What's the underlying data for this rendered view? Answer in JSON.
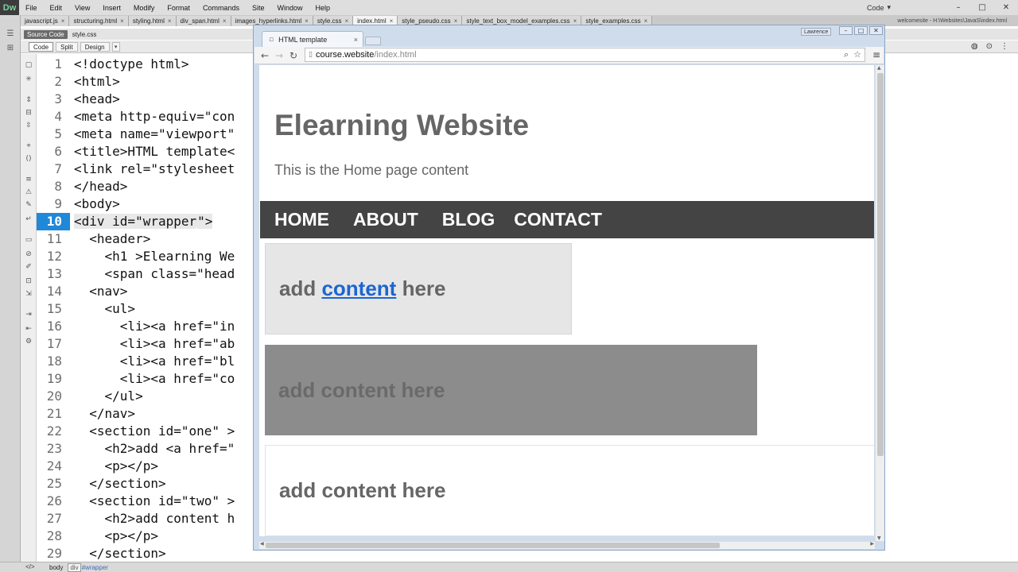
{
  "app": {
    "logo": "Dw",
    "menu": [
      "File",
      "Edit",
      "View",
      "Insert",
      "Modify",
      "Format",
      "Commands",
      "Site",
      "Window",
      "Help"
    ],
    "workspace": "Code",
    "window_controls": [
      "–",
      "□",
      "✕"
    ]
  },
  "doc_tabs": [
    {
      "label": "javascript.js"
    },
    {
      "label": "structuring.html"
    },
    {
      "label": "styling.html"
    },
    {
      "label": "div_span.html"
    },
    {
      "label": "images_hyperlinks.html"
    },
    {
      "label": "style.css"
    },
    {
      "label": "index.html"
    },
    {
      "label": "style_pseudo.css"
    },
    {
      "label": "style_text_box_model_examples.css"
    },
    {
      "label": "style_examples.css"
    }
  ],
  "doc_path": "welcomesite - H:\\Websites\\JavaS\\index.html",
  "related_files": {
    "source_code": "Source Code",
    "style_file": "style.css"
  },
  "view_buttons": {
    "code": "Code",
    "split": "Split",
    "design": "Design"
  },
  "line_numbers": [
    "1",
    "2",
    "3",
    "4",
    "5",
    "6",
    "7",
    "8",
    "9",
    "10",
    "11",
    "12",
    "13",
    "14",
    "15",
    "16",
    "17",
    "18",
    "19",
    "20",
    "21",
    "22",
    "23",
    "24",
    "25",
    "26",
    "27",
    "28",
    "29"
  ],
  "current_line": "10",
  "code_lines": [
    "<!doctype html>",
    "<html>",
    "<head>",
    "<meta http-equiv=\"con",
    "<meta name=\"viewport\"",
    "<title>HTML template<",
    "<link rel=\"stylesheet",
    "</head>",
    "<body>",
    "<div id=\"wrapper",
    "  <header>",
    "    <h1 >Elearning We",
    "    <span class=\"head",
    "  <nav>",
    "    <ul>",
    "      <li><a href=\"in",
    "      <li><a href=\"ab",
    "      <li><a href=\"bl",
    "      <li><a href=\"co",
    "    </ul>",
    "  </nav>",
    "  <section id=\"one\" >",
    "    <h2>add <a href=\"",
    "    <p></p>",
    "  </section>",
    "  <section id=\"two\" >",
    "    <h2>add content h",
    "    <p></p>",
    "  </section>"
  ],
  "current_line_tail": "\">",
  "status_bar": {
    "arrow": "</>",
    "tag1": "body",
    "tag2": "div",
    "tag2_id": "#wrapper"
  },
  "browser": {
    "tab_title": "HTML template",
    "tab_close": "×",
    "user_badge": "Lawrence",
    "window_controls": [
      "–",
      "□",
      "✕"
    ],
    "url_host": "course.website",
    "url_path": "/index.html",
    "page": {
      "title": "Elearning Website",
      "subtitle": "This is the Home page content",
      "nav": [
        "HOME",
        "ABOUT",
        "BLOG",
        "CONTACT"
      ],
      "section_one": {
        "prefix": "add ",
        "link": "content",
        "suffix": " here"
      },
      "section_two": "add content here",
      "section_three": "add content here"
    }
  },
  "colors": {
    "line_highlight": "#1f88d8",
    "nav_bg": "#444444",
    "section_one_bg": "#e6e6e6",
    "section_two_bg": "#8c8c8c",
    "link": "#1b66d1",
    "heading_text": "#666666"
  }
}
